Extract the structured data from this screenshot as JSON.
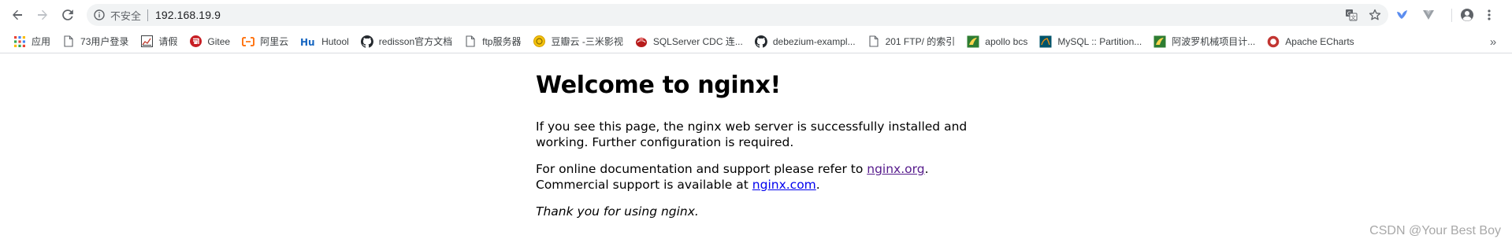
{
  "browser": {
    "address_bar": {
      "security_text": "不安全",
      "url": "192.168.19.9"
    },
    "icons": {
      "back": "arrow-left-icon",
      "forward": "arrow-right-icon",
      "reload": "reload-icon",
      "info": "info-icon",
      "translate": "translate-icon",
      "bookmark_star": "star-icon",
      "extension_1": "bird-extension-icon",
      "extension_2": "vue-extension-icon",
      "profile": "account-circle-icon",
      "menu": "kebab-menu-icon"
    }
  },
  "bookmarks": {
    "items": [
      {
        "label": "应用",
        "icon": "apps-grid-icon"
      },
      {
        "label": "73用户登录",
        "icon": "page-icon"
      },
      {
        "label": "请假",
        "icon": "chart-icon"
      },
      {
        "label": "Gitee",
        "icon": "gitee-icon"
      },
      {
        "label": "阿里云",
        "icon": "aliyun-icon"
      },
      {
        "label": "Hutool",
        "icon": "hutool-icon"
      },
      {
        "label": "redisson官方文档",
        "icon": "github-icon"
      },
      {
        "label": "ftp服务器",
        "icon": "page-icon"
      },
      {
        "label": "豆瓣云 -三米影视",
        "icon": "coin-icon"
      },
      {
        "label": "SQLServer CDC 连...",
        "icon": "sqlserver-icon"
      },
      {
        "label": "debezium-exampl...",
        "icon": "github-icon"
      },
      {
        "label": "201 FTP/ 的索引",
        "icon": "page-icon"
      },
      {
        "label": "apollo  bcs",
        "icon": "apollo-icon"
      },
      {
        "label": "MySQL :: Partition...",
        "icon": "mysql-icon"
      },
      {
        "label": "阿波罗机械项目计...",
        "icon": "apollo-icon"
      },
      {
        "label": "Apache ECharts",
        "icon": "echarts-icon"
      }
    ],
    "overflow": "»"
  },
  "page": {
    "heading": "Welcome to nginx!",
    "p1_line1": "If you see this page, the nginx web server is successfully installed and",
    "p1_line2": "working. Further configuration is required.",
    "p2_line1_prefix": "For online documentation and support please refer to ",
    "p2_link1": "nginx.org",
    "p2_line1_suffix": ".",
    "p2_line2_prefix": "Commercial support is available at ",
    "p2_link2": "nginx.com",
    "p2_line2_suffix": ".",
    "p3": "Thank you for using nginx."
  },
  "watermark": "CSDN @Your Best Boy",
  "colors": {
    "omnibox_bg": "#f1f3f4",
    "visited_link": "#551a8b",
    "link": "#0000ee"
  }
}
